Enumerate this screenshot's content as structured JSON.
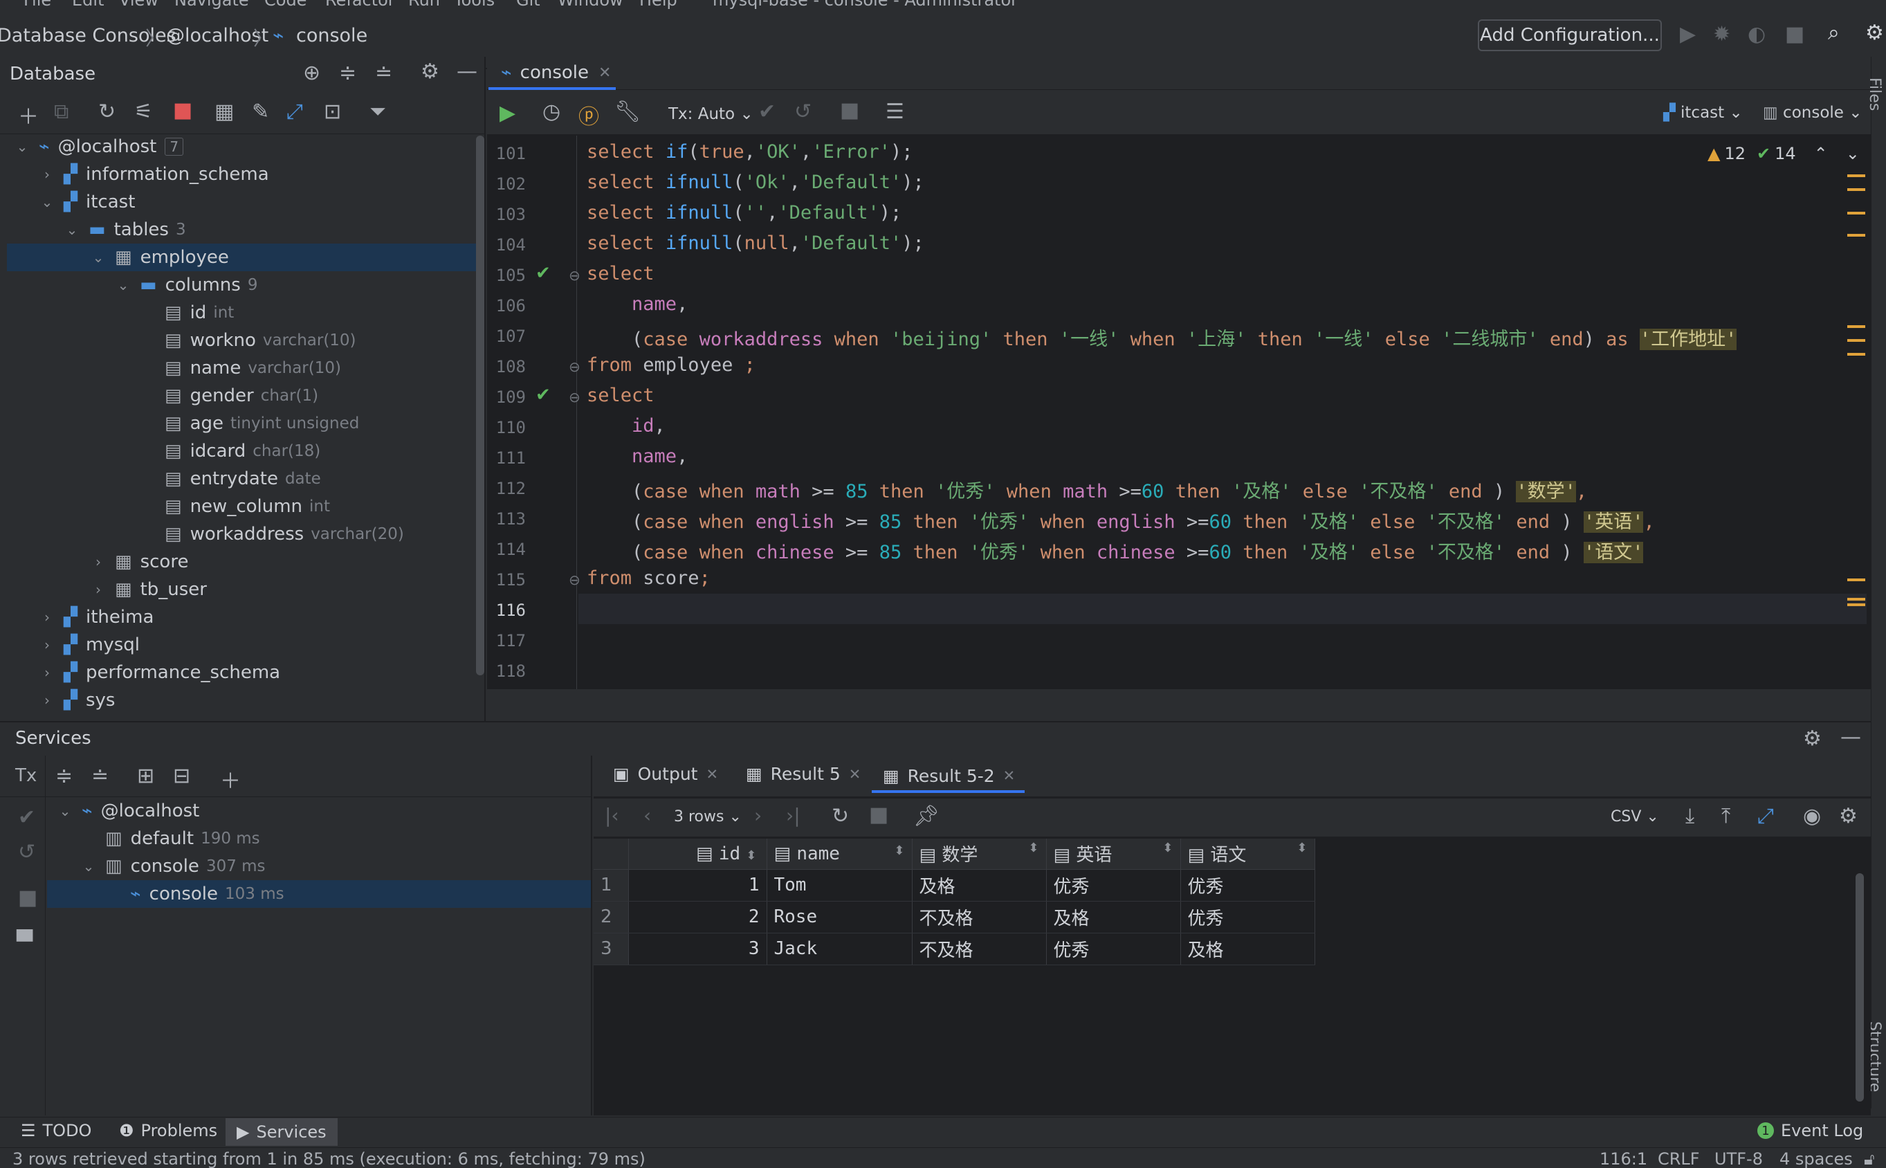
{
  "menu": [
    "File",
    "Edit",
    "View",
    "Navigate",
    "Code",
    "Refactor",
    "Run",
    "Tools",
    "Git",
    "Window",
    "Help"
  ],
  "window_title": "mysql-base - console - Administrator",
  "breadcrumb": [
    "Database Consoles",
    "@localhost",
    "console"
  ],
  "navbar": {
    "add_config": "Add Configuration..."
  },
  "database_panel": {
    "title": "Database",
    "tree": {
      "root": {
        "label": "@localhost",
        "count": "7"
      },
      "information_schema": "information_schema",
      "itcast": "itcast",
      "tables": {
        "label": "tables",
        "count": "3"
      },
      "employee": "employee",
      "columns": {
        "label": "columns",
        "count": "9"
      },
      "cols": [
        {
          "name": "id",
          "type": "int"
        },
        {
          "name": "workno",
          "type": "varchar(10)"
        },
        {
          "name": "name",
          "type": "varchar(10)"
        },
        {
          "name": "gender",
          "type": "char(1)"
        },
        {
          "name": "age",
          "type": "tinyint unsigned"
        },
        {
          "name": "idcard",
          "type": "char(18)"
        },
        {
          "name": "entrydate",
          "type": "date"
        },
        {
          "name": "new_column",
          "type": "int"
        },
        {
          "name": "workaddress",
          "type": "varchar(20)"
        }
      ],
      "score": "score",
      "tb_user": "tb_user",
      "itheima": "itheima",
      "mysql": "mysql",
      "performance_schema": "performance_schema",
      "sys": "sys"
    }
  },
  "editor": {
    "tab": "console",
    "tx": "Tx: Auto",
    "schema": "itcast",
    "session": "console",
    "warnings": "12",
    "oks": "14",
    "line_numbers": [
      "101",
      "102",
      "103",
      "104",
      "105",
      "106",
      "107",
      "108",
      "109",
      "110",
      "111",
      "112",
      "113",
      "114",
      "115",
      "116",
      "117",
      "118"
    ]
  },
  "services": {
    "title": "Services",
    "tree": {
      "root": "@localhost",
      "default": {
        "label": "default",
        "time": "190 ms"
      },
      "console_group": {
        "label": "console",
        "time": "307 ms"
      },
      "console": {
        "label": "console",
        "time": "103 ms"
      }
    },
    "result_tabs": [
      "Output",
      "Result 5",
      "Result 5-2"
    ],
    "rows_label": "3 rows",
    "export_format": "CSV",
    "columns": [
      "id",
      "name",
      "数学",
      "英语",
      "语文"
    ],
    "rows": [
      {
        "n": "1",
        "id": "1",
        "name": "Tom",
        "math": "及格",
        "english": "优秀",
        "chinese": "优秀"
      },
      {
        "n": "2",
        "id": "2",
        "name": "Rose",
        "math": "不及格",
        "english": "及格",
        "chinese": "优秀"
      },
      {
        "n": "3",
        "id": "3",
        "name": "Jack",
        "math": "不及格",
        "english": "优秀",
        "chinese": "及格"
      }
    ]
  },
  "tool_tabs": [
    "TODO",
    "Problems",
    "Services"
  ],
  "event_log": {
    "count": "1",
    "label": "Event Log"
  },
  "status": {
    "message": "3 rows retrieved starting from 1 in 85 ms (execution: 6 ms, fetching: 79 ms)",
    "position": "116:1",
    "line_sep": "CRLF",
    "encoding": "UTF-8",
    "indent": "4 spaces"
  },
  "side_labels": {
    "files": "Files",
    "structure": "Structure"
  }
}
